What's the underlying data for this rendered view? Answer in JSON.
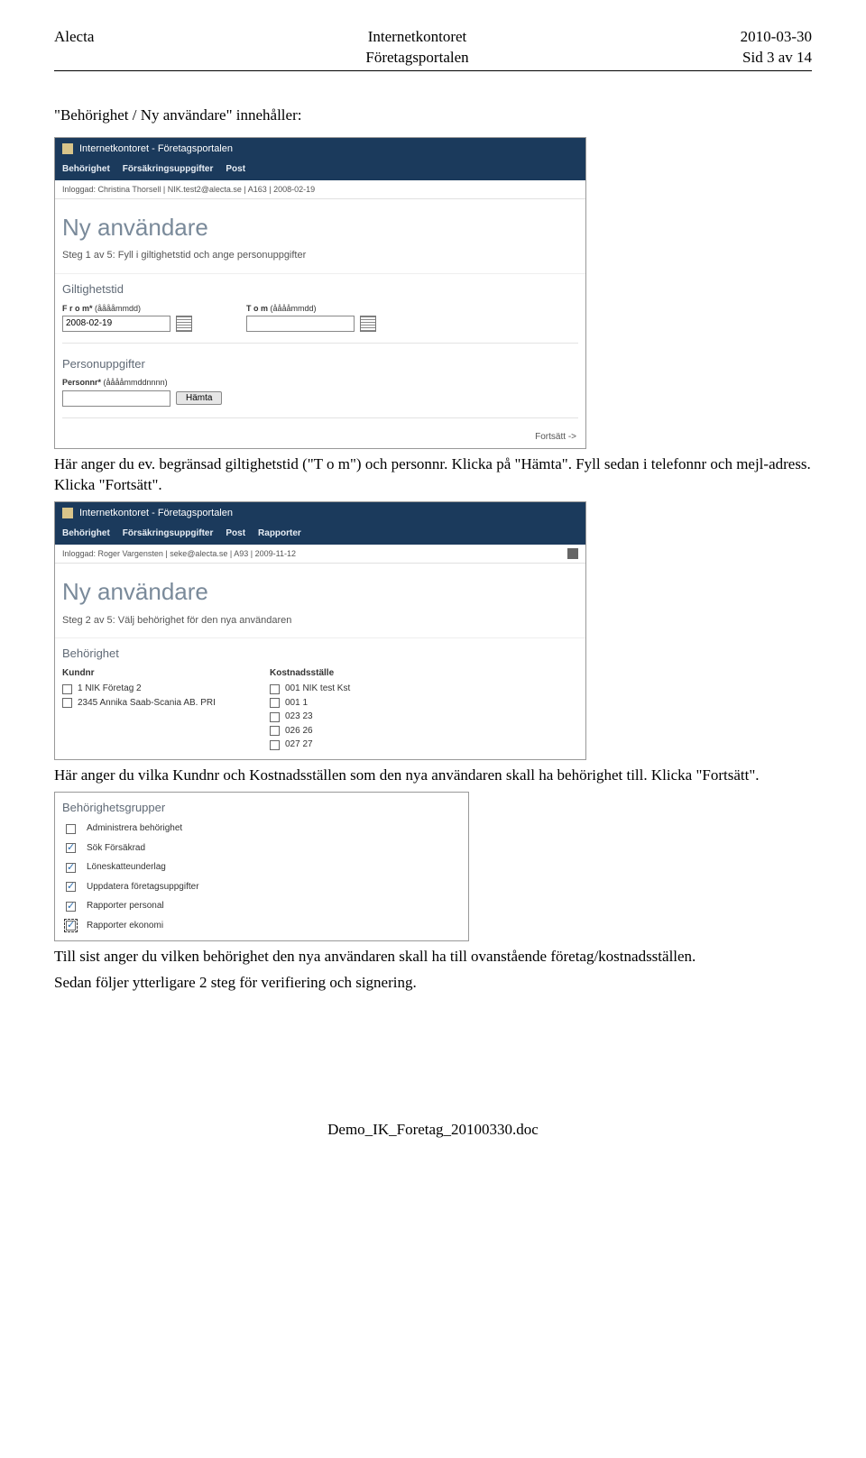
{
  "header": {
    "left": "Alecta",
    "center1": "Internetkontoret",
    "center2": "Företagsportalen",
    "right_date": "2010-03-30",
    "right_page": "Sid 3 av 14"
  },
  "heading1": "\"Behörighet / Ny användare\" innehåller:",
  "shot1": {
    "title": "Internetkontoret  - Företagsportalen",
    "menu": [
      "Behörighet",
      "Försäkringsuppgifter",
      "Post"
    ],
    "loggedin": "Inloggad: Christina Thorsell | NIK.test2@alecta.se | A163 | 2008-02-19",
    "h1": "Ny användare",
    "step": "Steg 1 av 5: Fyll i giltighetstid och ange personuppgifter",
    "sub_gilt": "Giltighetstid",
    "from_label": "F r o m*",
    "from_hint": "(ååååmmdd)",
    "from_value": "2008-02-19",
    "tom_label": "T o m",
    "tom_hint": "(ååååmmdd)",
    "tom_value": "",
    "sub_person": "Personuppgifter",
    "personnr_label": "Personnr*",
    "personnr_hint": "(ååååmmddnnnn)",
    "personnr_value": "",
    "hamta": "Hämta",
    "fortsatt": "Fortsätt ->"
  },
  "para1": "Här anger du ev. begränsad giltighetstid (\"T o m\") och personnr. Klicka på \"Hämta\". Fyll sedan i telefonnr och mejl-adress. Klicka \"Fortsätt\".",
  "shot2": {
    "title": "Internetkontoret  - Företagsportalen",
    "menu": [
      "Behörighet",
      "Försäkringsuppgifter",
      "Post",
      "Rapporter"
    ],
    "loggedin": "Inloggad: Roger Vargensten | seke@alecta.se | A93 | 2009-11-12",
    "h1": "Ny användare",
    "step": "Steg 2 av 5: Välj behörighet för den nya användaren",
    "sub_beh": "Behörighet",
    "col_kund": "Kundnr",
    "col_kost": "Kostnadsställe",
    "kund_items": [
      "1 NIK Företag 2",
      "2345 Annika Saab-Scania AB. PRI"
    ],
    "kost_items": [
      "001 NIK test Kst",
      "001 1",
      "023 23",
      "026 26",
      "027 27"
    ]
  },
  "para2": "Här anger du vilka Kundnr och Kostnadsställen som den nya användaren skall ha behörighet till. Klicka \"Fortsätt\".",
  "shot3": {
    "sub": "Behörighetsgrupper",
    "items": [
      {
        "label": "Administrera behörighet",
        "checked": false,
        "dotted": false
      },
      {
        "label": "Sök Försäkrad",
        "checked": true,
        "dotted": false
      },
      {
        "label": "Löneskatteunderlag",
        "checked": true,
        "dotted": false
      },
      {
        "label": "Uppdatera företagsuppgifter",
        "checked": true,
        "dotted": false
      },
      {
        "label": "Rapporter personal",
        "checked": true,
        "dotted": false
      },
      {
        "label": "Rapporter ekonomi",
        "checked": true,
        "dotted": true
      }
    ]
  },
  "para3": "Till sist anger du vilken behörighet den nya användaren skall ha till ovanstående företag/kostnadsställen.",
  "para4": "Sedan följer ytterligare 2 steg för verifiering och signering.",
  "footer": "Demo_IK_Foretag_20100330.doc"
}
